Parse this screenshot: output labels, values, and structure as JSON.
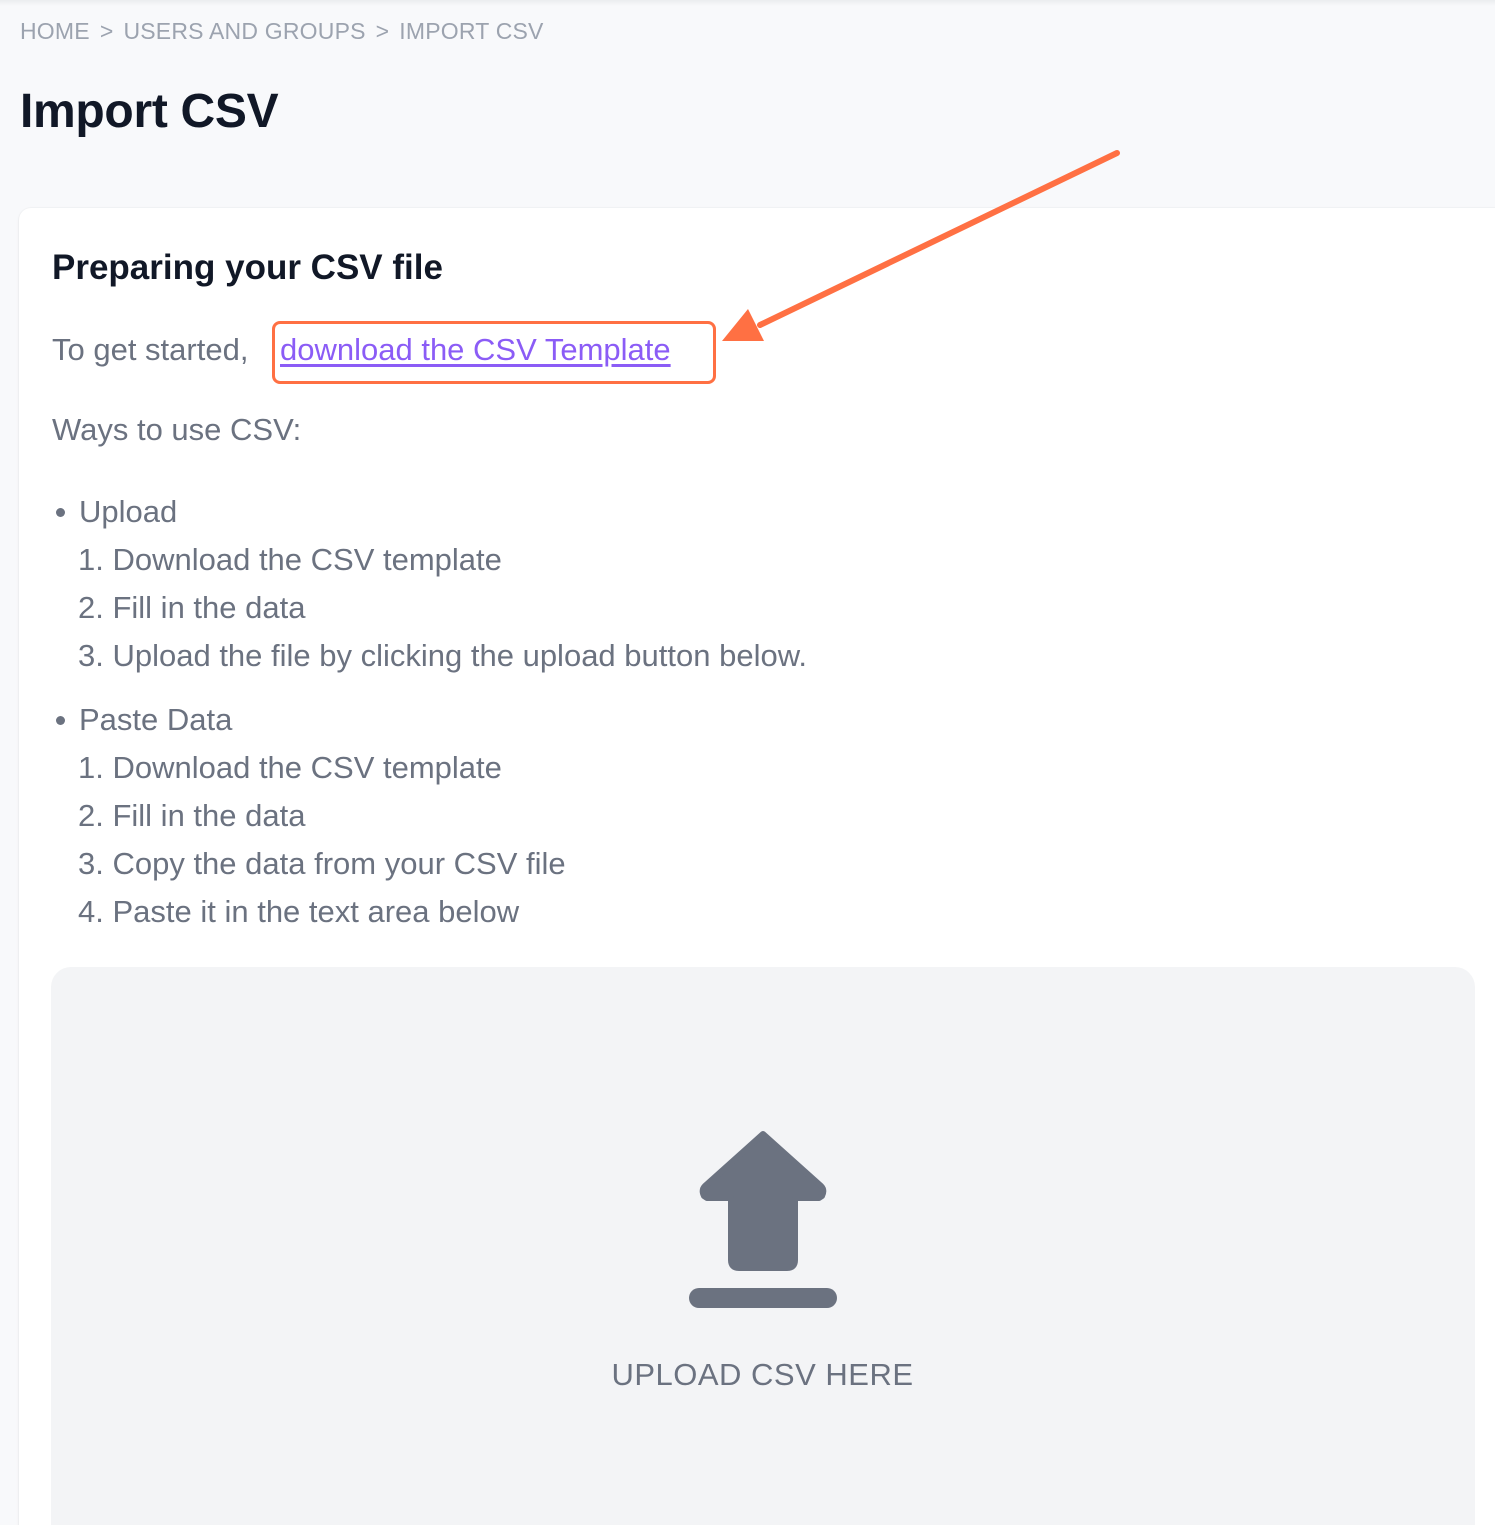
{
  "breadcrumb": {
    "items": [
      "HOME",
      "USERS AND GROUPS",
      "IMPORT CSV"
    ],
    "separator": ">"
  },
  "page": {
    "title": "Import CSV"
  },
  "card": {
    "title": "Preparing your CSV file",
    "intro_text": "To get started,",
    "template_link": "download the CSV Template",
    "ways_label": "Ways to use CSV:",
    "methods": [
      {
        "label": "Upload",
        "steps": [
          "1. Download the CSV template",
          "2. Fill in the data",
          "3. Upload the file by clicking the upload button below."
        ]
      },
      {
        "label": "Paste Data",
        "steps": [
          "1. Download the CSV template",
          "2. Fill in the data",
          "3. Copy the data from your CSV file",
          "4. Paste it in the text area below"
        ]
      }
    ]
  },
  "upload_zone": {
    "label": "UPLOAD CSV HERE",
    "icon": "upload-icon"
  },
  "colors": {
    "annotation": "#ff7043",
    "link": "#8b5cf6",
    "heading": "#111827",
    "body_text": "#6b7280",
    "icon": "#6b7280"
  }
}
